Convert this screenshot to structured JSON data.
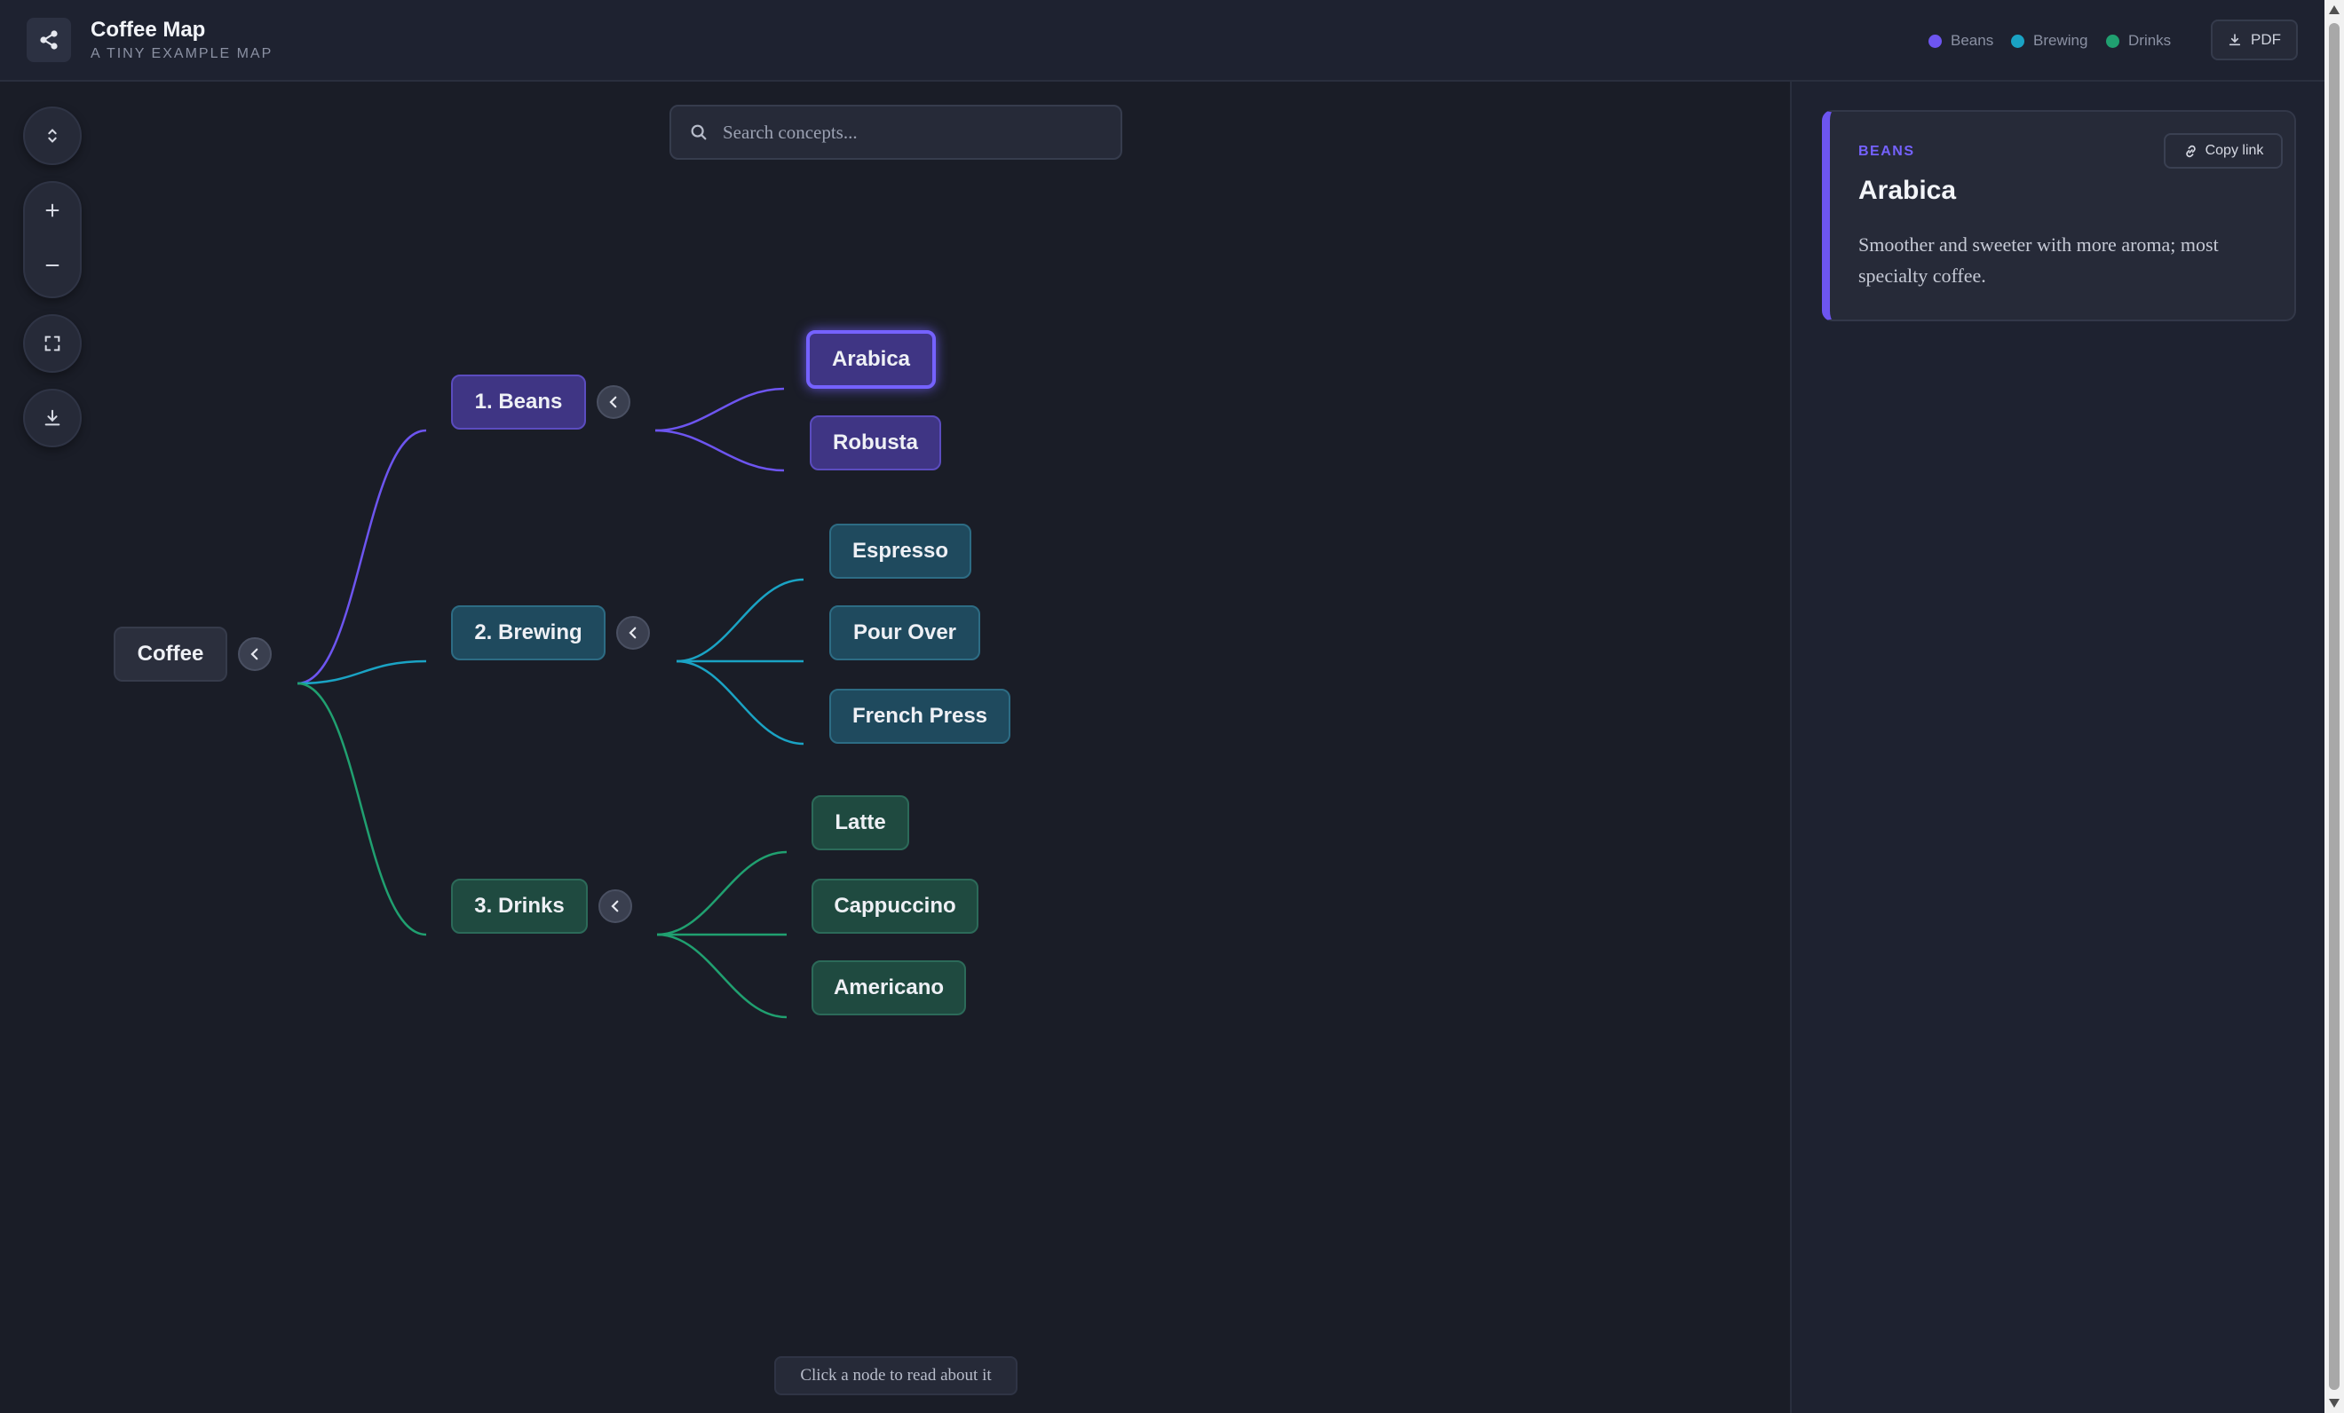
{
  "header": {
    "title": "Coffee Map",
    "subtitle": "A TINY EXAMPLE MAP",
    "legend": [
      {
        "label": "Beans",
        "color": "#6d55f0"
      },
      {
        "label": "Brewing",
        "color": "#1aa3c4"
      },
      {
        "label": "Drinks",
        "color": "#20a070"
      }
    ],
    "pdf_label": "PDF"
  },
  "toolbar": {
    "icons": [
      "expand-collapse-icon",
      "zoom-in-icon",
      "zoom-out-icon",
      "fit-screen-icon",
      "download-icon"
    ]
  },
  "search": {
    "placeholder": "Search concepts..."
  },
  "map": {
    "root": "Coffee",
    "branches": [
      {
        "label": "1. Beans",
        "children": [
          "Arabica",
          "Robusta"
        ]
      },
      {
        "label": "2. Brewing",
        "children": [
          "Espresso",
          "Pour Over",
          "French Press"
        ]
      },
      {
        "label": "3. Drinks",
        "children": [
          "Latte",
          "Cappuccino",
          "Americano"
        ]
      }
    ],
    "selected": "Arabica"
  },
  "hint": "Click a node to read about it",
  "details": {
    "category": "BEANS",
    "title": "Arabica",
    "description": "Smoother and sweeter with more aroma; most specialty coffee.",
    "copy_label": "Copy link"
  }
}
